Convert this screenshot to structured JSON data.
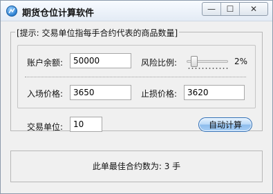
{
  "window": {
    "title": "期货仓位计算软件",
    "controls": {
      "minimize": "—",
      "maximize": "☐",
      "close": "✕"
    }
  },
  "hint": "[提示: 交易单位指每手合约代表的商品数量]",
  "fields": {
    "account_balance": {
      "label": "账户余额:",
      "value": "50000"
    },
    "risk_ratio": {
      "label": "风险比例:",
      "value_text": "2%",
      "level_percent": 2
    },
    "entry_price": {
      "label": "入场价格:",
      "value": "3650"
    },
    "stop_price": {
      "label": "止损价格:",
      "value": "3620"
    },
    "trade_unit": {
      "label": "交易单位:",
      "value": "10"
    }
  },
  "calc_button": "自动计算",
  "result": "此单最佳合约数为: 3 手"
}
